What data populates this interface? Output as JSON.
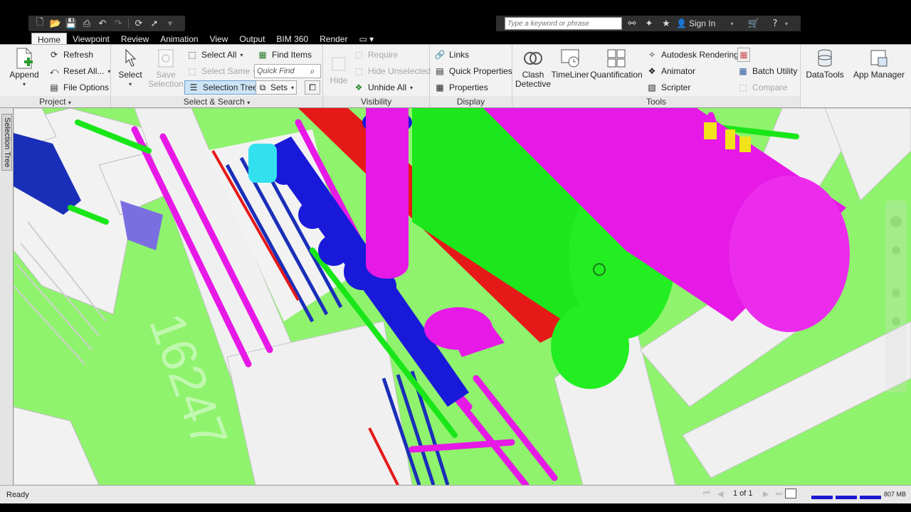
{
  "quick_access": {
    "icons": [
      "new-icon",
      "open-icon",
      "save-icon",
      "print-icon",
      "undo-icon",
      "redo-icon",
      "refresh-icon",
      "select-icon",
      "customize-icon"
    ]
  },
  "help": {
    "search_placeholder": "Type a keyword or phrase",
    "signin_label": "Sign In"
  },
  "tabs": [
    {
      "label": "Home",
      "active": true
    },
    {
      "label": "Viewpoint"
    },
    {
      "label": "Review"
    },
    {
      "label": "Animation"
    },
    {
      "label": "View"
    },
    {
      "label": "Output"
    },
    {
      "label": "BIM 360"
    },
    {
      "label": "Render"
    }
  ],
  "ribbon": {
    "project": {
      "title": "Project",
      "append": "Append",
      "refresh": "Refresh",
      "reset_all": "Reset All...",
      "file_options": "File Options"
    },
    "select": {
      "title": "Select & Search",
      "select": "Select",
      "save_selection_1": "Save",
      "save_selection_2": "Selection",
      "select_all": "Select All",
      "select_same": "Select Same",
      "selection_tree": "Selection Tree",
      "find_items": "Find Items",
      "quick_find_placeholder": "Quick Find",
      "sets": "Sets"
    },
    "visibility": {
      "title": "Visibility",
      "hide": "Hide",
      "require": "Require",
      "hide_unselected": "Hide Unselected",
      "unhide_all": "Unhide All"
    },
    "display": {
      "title": "Display",
      "links": "Links",
      "quick_properties": "Quick Properties",
      "properties": "Properties"
    },
    "tools": {
      "title": "Tools",
      "clash_1": "Clash",
      "clash_2": "Detective",
      "timeliner": "TimeLiner",
      "quantification": "Quantification",
      "autodesk_rendering": "Autodesk Rendering",
      "animator": "Animator",
      "scripter": "Scripter",
      "batch_utility": "Batch Utility",
      "compare": "Compare",
      "datatools": "DataTools",
      "app_manager": "App Manager"
    }
  },
  "side_tab": {
    "label": "Selection Tree"
  },
  "status": {
    "text": "Ready",
    "page": "1 of 1",
    "memory": "807 MB"
  },
  "colors": {
    "viewport_bg": "#8ff36d",
    "pipe_magenta": "#e619e6",
    "pipe_green": "#19e619",
    "pipe_red": "#e61919",
    "pipe_blue": "#1919d9",
    "pipe_cyan": "#33e0ee",
    "steel_white": "#f0f0f0"
  }
}
